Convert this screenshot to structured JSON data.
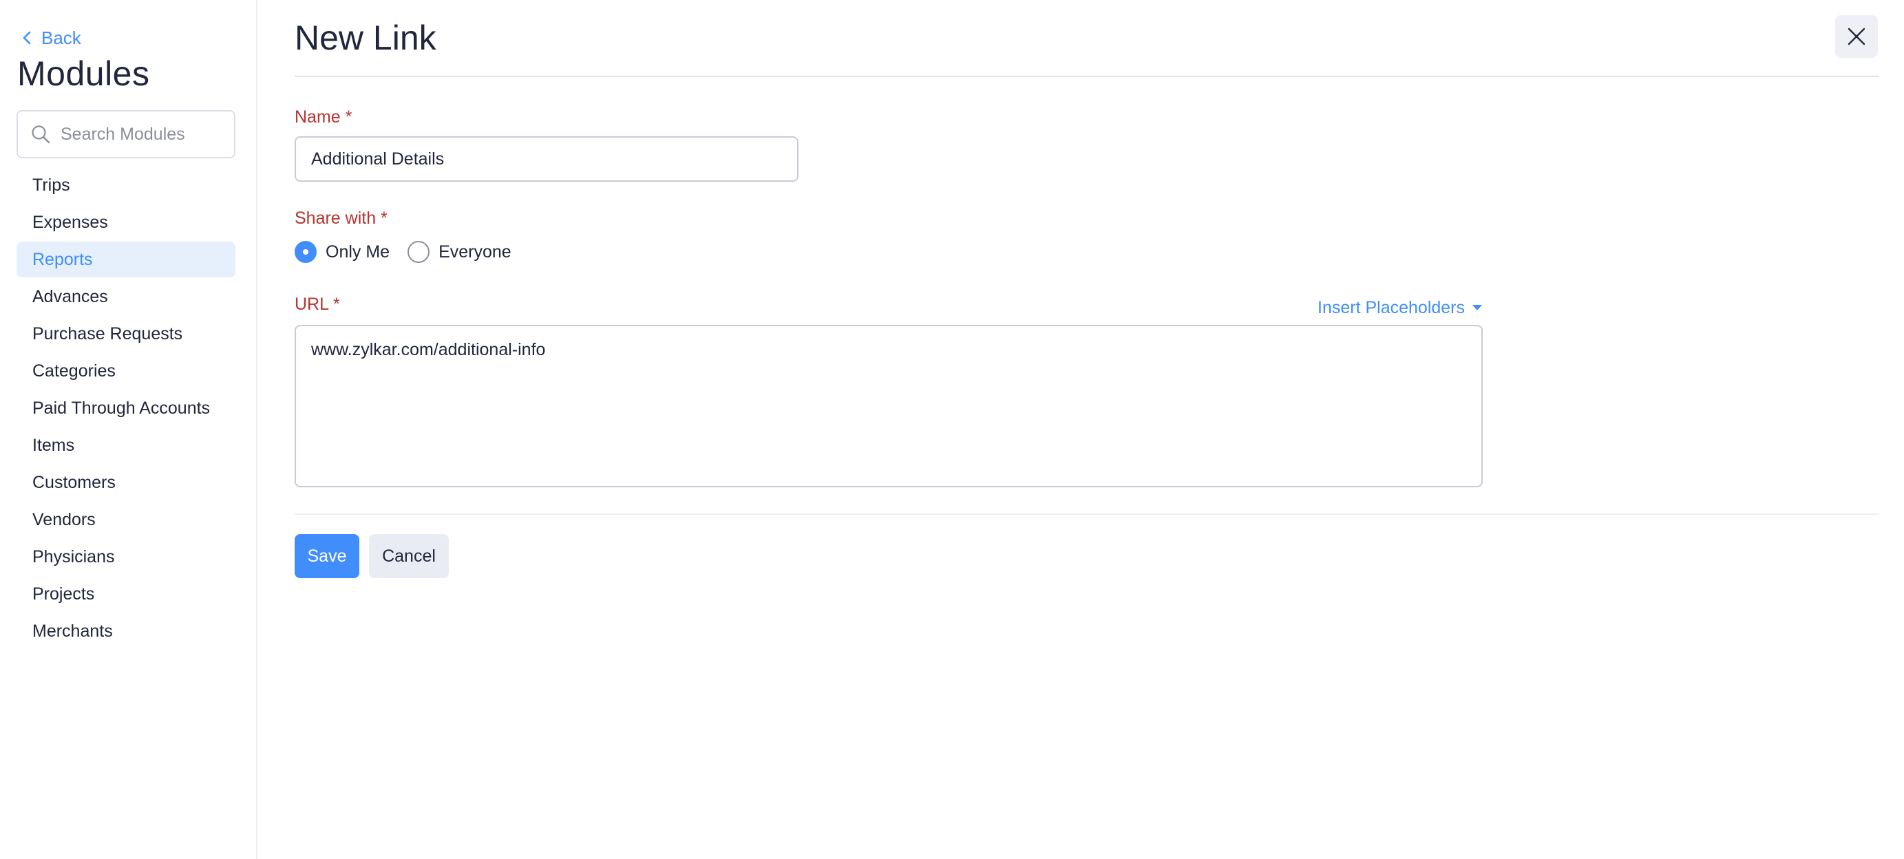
{
  "sidebar": {
    "back_label": "Back",
    "title": "Modules",
    "search_placeholder": "Search Modules",
    "items": [
      {
        "label": "Trips",
        "active": false
      },
      {
        "label": "Expenses",
        "active": false
      },
      {
        "label": "Reports",
        "active": true
      },
      {
        "label": "Advances",
        "active": false
      },
      {
        "label": "Purchase Requests",
        "active": false
      },
      {
        "label": "Categories",
        "active": false
      },
      {
        "label": "Paid Through Accounts",
        "active": false
      },
      {
        "label": "Items",
        "active": false
      },
      {
        "label": "Customers",
        "active": false
      },
      {
        "label": "Vendors",
        "active": false
      },
      {
        "label": "Physicians",
        "active": false
      },
      {
        "label": "Projects",
        "active": false
      },
      {
        "label": "Merchants",
        "active": false
      }
    ]
  },
  "form": {
    "title": "New Link",
    "name_label": "Name *",
    "name_value": "Additional Details",
    "share_label": "Share with *",
    "share_options": [
      {
        "label": "Only Me",
        "checked": true
      },
      {
        "label": "Everyone",
        "checked": false
      }
    ],
    "url_label": "URL *",
    "insert_placeholders_label": "Insert Placeholders",
    "url_value": "www.zylkar.com/additional-info",
    "save_label": "Save",
    "cancel_label": "Cancel"
  },
  "colors": {
    "accent": "#408dfb",
    "required_label": "#b8342f",
    "active_bg": "#e6f0fd"
  },
  "icons": {
    "back": "chevron-left-icon",
    "search": "search-icon",
    "close": "close-icon",
    "dropdown": "caret-down-icon"
  }
}
